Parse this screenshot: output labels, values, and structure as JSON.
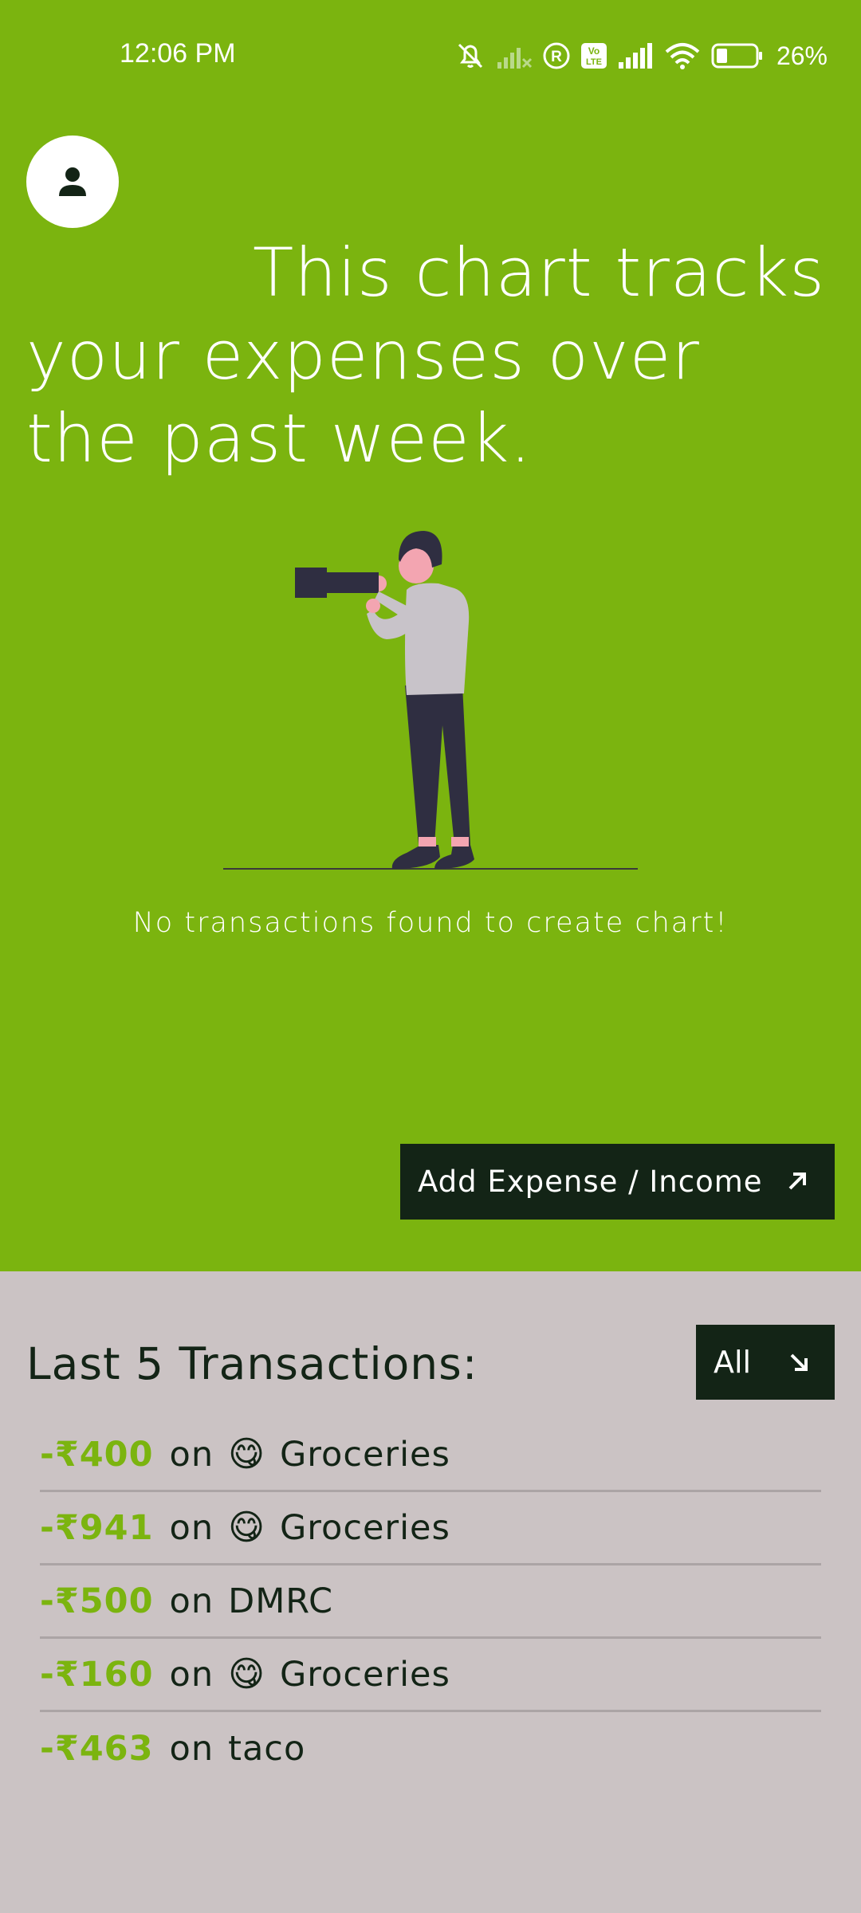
{
  "status_bar": {
    "time": "12:06 PM",
    "battery": "26%"
  },
  "header": {
    "avatar_icon": "person-icon",
    "headline": "This chart tracks your expenses over the past week."
  },
  "chart_area": {
    "empty_message": "No transactions found to create chart!",
    "illustration": "person-with-binoculars"
  },
  "actions": {
    "add_label": "Add Expense / Income",
    "add_icon": "arrow-up-right-icon"
  },
  "transactions": {
    "title": "Last 5 Transactions:",
    "filter_label": "All",
    "filter_icon": "arrow-down-right-icon",
    "items": [
      {
        "amount": "-₹400",
        "on": "on",
        "emoji": "😋",
        "category": "Groceries"
      },
      {
        "amount": "-₹941",
        "on": "on",
        "emoji": "😋",
        "category": "Groceries"
      },
      {
        "amount": "-₹500",
        "on": "on",
        "emoji": "",
        "category": "DMRC"
      },
      {
        "amount": "-₹160",
        "on": "on",
        "emoji": "😋",
        "category": "Groceries"
      },
      {
        "amount": "-₹463",
        "on": "on",
        "emoji": "",
        "category": "taco"
      }
    ]
  },
  "colors": {
    "accent": "#7bb40f",
    "dark": "#132416",
    "panel": "#cbc3c4"
  }
}
